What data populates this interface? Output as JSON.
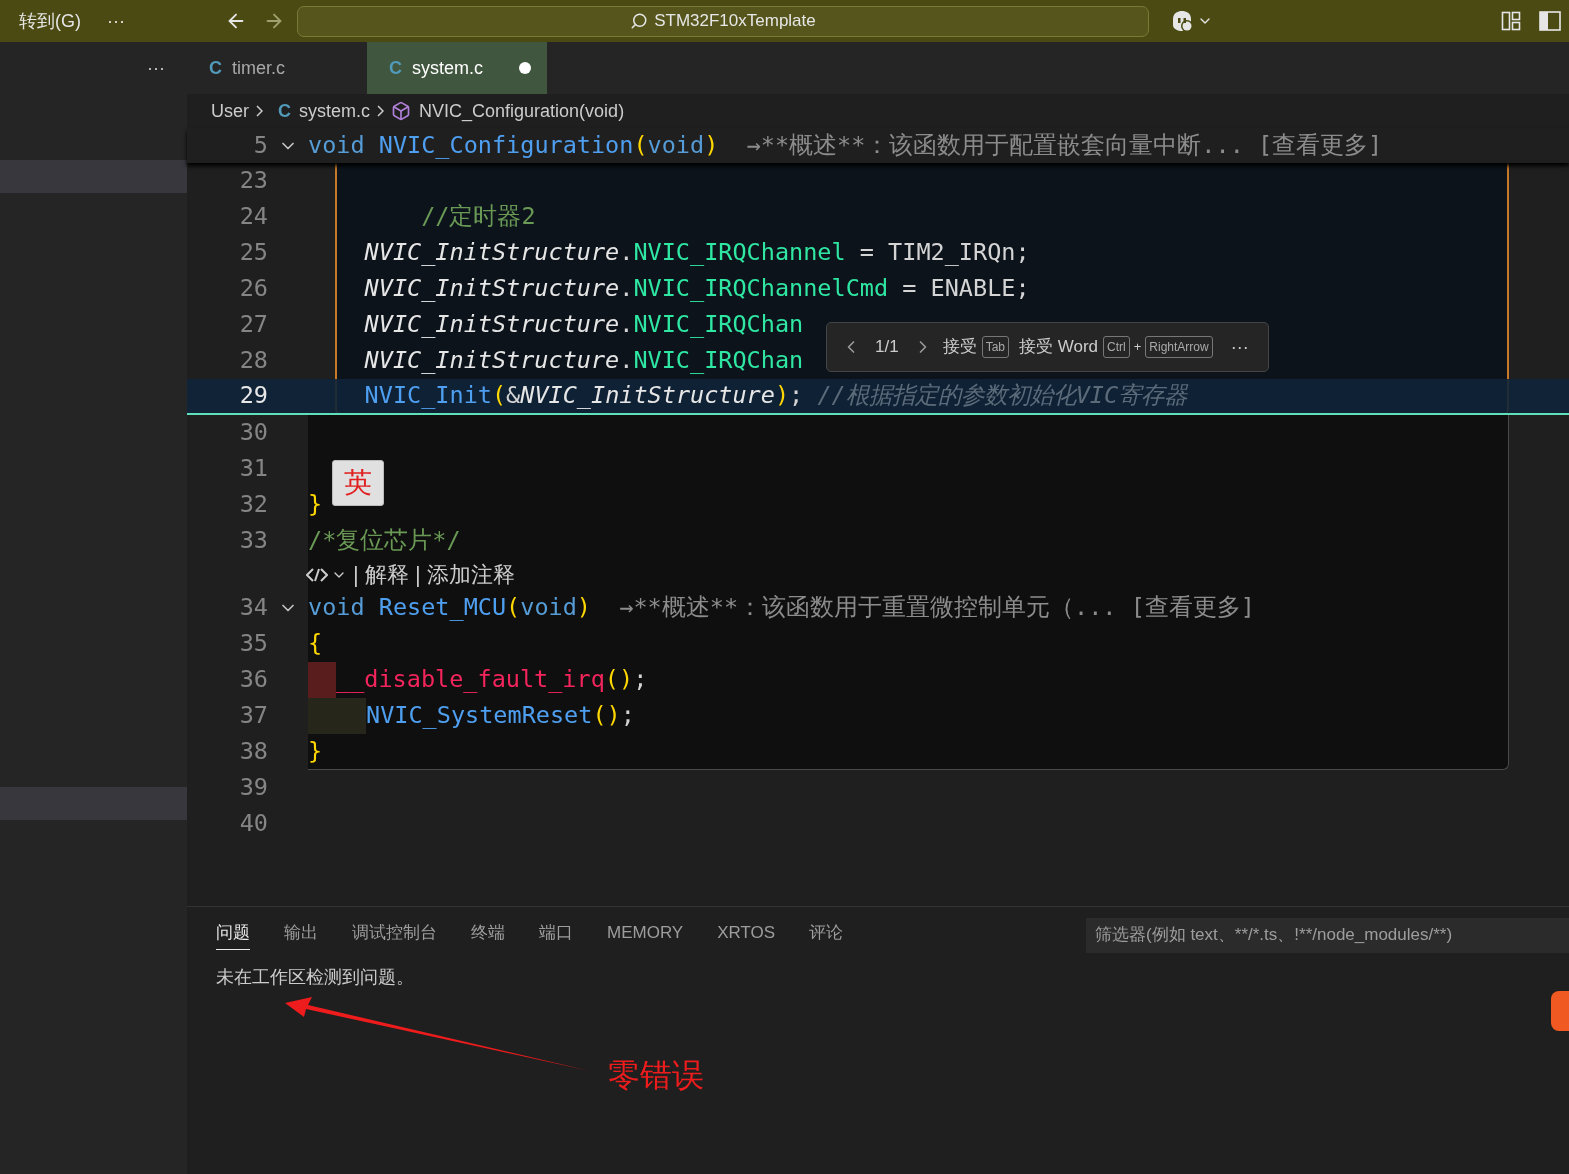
{
  "titlebar": {
    "menu": "转到(G)",
    "more": "···",
    "search": "STM32F10xTemplate"
  },
  "sidebar": {
    "more": "···"
  },
  "tabs": [
    {
      "icon": "C",
      "label": "timer.c",
      "selected": false,
      "modified": false
    },
    {
      "icon": "C",
      "label": "system.c",
      "selected": true,
      "modified": true
    }
  ],
  "breadcrumbs": [
    {
      "kind": "folder",
      "label": "User"
    },
    {
      "kind": "file",
      "icon": "C",
      "label": "system.c"
    },
    {
      "kind": "symbol",
      "label": "NVIC_Configuration(void)"
    }
  ],
  "sticky_line": {
    "number": "5",
    "expanded": true,
    "tokens": [
      {
        "kind": "kw",
        "text": "void "
      },
      {
        "kind": "func",
        "text": "NVIC_Configuration"
      },
      {
        "kind": "paren",
        "text": "("
      },
      {
        "kind": "kw",
        "text": "void"
      },
      {
        "kind": "paren",
        "text": ")"
      },
      {
        "kind": "hint",
        "text": "  →**概述**：该函数用于配置嵌套向量中断... [查看更多]"
      }
    ]
  },
  "lines": [
    {
      "kind": "suggested",
      "number": "23"
    },
    {
      "kind": "suggested",
      "number": "24",
      "tokens": [
        {
          "kind": "comment",
          "text": "        //定时器2"
        }
      ]
    },
    {
      "kind": "suggested",
      "number": "25",
      "tokens": [
        {
          "kind": "var",
          "text": "    NVIC_InitStructure"
        },
        {
          "kind": "plain",
          "text": "."
        },
        {
          "kind": "field",
          "text": "NVIC_IRQChannel"
        },
        {
          "kind": "plain",
          "text": " = TIM2_IRQn;"
        }
      ]
    },
    {
      "kind": "suggested",
      "number": "26",
      "tokens": [
        {
          "kind": "var",
          "text": "    NVIC_InitStructure"
        },
        {
          "kind": "plain",
          "text": "."
        },
        {
          "kind": "field",
          "text": "NVIC_IRQChannelCmd"
        },
        {
          "kind": "plain",
          "text": " = ENABLE;"
        }
      ]
    },
    {
      "kind": "suggested",
      "number": "27",
      "tokens": [
        {
          "kind": "var",
          "text": "    NVIC_InitStructure"
        },
        {
          "kind": "plain",
          "text": "."
        },
        {
          "kind": "field",
          "text": "NVIC_IRQChan"
        }
      ]
    },
    {
      "kind": "suggested",
      "number": "28",
      "tokens": [
        {
          "kind": "var",
          "text": "    NVIC_InitStructure"
        },
        {
          "kind": "plain",
          "text": "."
        },
        {
          "kind": "field",
          "text": "NVIC_IRQChan"
        }
      ]
    },
    {
      "kind": "current",
      "number": "29",
      "tokens": [
        {
          "kind": "func",
          "text": "    NVIC_Init"
        },
        {
          "kind": "paren",
          "text": "("
        },
        {
          "kind": "plain",
          "text": "&"
        },
        {
          "kind": "var",
          "text": "NVIC_InitStructure"
        },
        {
          "kind": "paren",
          "text": ")"
        },
        {
          "kind": "plain",
          "text": "; "
        },
        {
          "kind": "ghost",
          "text": "//根据指定的参数初始化VIC寄存器"
        }
      ]
    },
    {
      "kind": "preview",
      "number": "30"
    },
    {
      "kind": "preview",
      "number": "31"
    },
    {
      "kind": "preview",
      "number": "32",
      "tokens": [
        {
          "kind": "paren",
          "text": "}"
        }
      ]
    },
    {
      "kind": "preview",
      "number": "33",
      "tokens": [
        {
          "kind": "comment",
          "text": "/*复位芯片*/"
        }
      ]
    },
    {
      "kind": "codelens",
      "text": "| 解释 | 添加注释"
    },
    {
      "kind": "preview",
      "number": "34",
      "expanded": true,
      "tokens": [
        {
          "kind": "kw",
          "text": "void "
        },
        {
          "kind": "func",
          "text": "Reset_MCU"
        },
        {
          "kind": "paren",
          "text": "("
        },
        {
          "kind": "kw",
          "text": "void"
        },
        {
          "kind": "paren",
          "text": ")"
        },
        {
          "kind": "hint",
          "text": "  →**概述**：该函数用于重置微控制单元（... [查看更多]"
        }
      ]
    },
    {
      "kind": "preview",
      "number": "35",
      "tokens": [
        {
          "kind": "paren",
          "text": "{"
        }
      ]
    },
    {
      "kind": "deleted",
      "number": "36",
      "tokens": [
        {
          "kind": "error",
          "text": "__disable_fault_irq"
        },
        {
          "kind": "paren",
          "text": "()"
        },
        {
          "kind": "plain",
          "text": ";"
        }
      ]
    },
    {
      "kind": "inserted",
      "number": "37",
      "tokens": [
        {
          "kind": "func",
          "text": "NVIC_SystemReset"
        },
        {
          "kind": "paren",
          "text": "()"
        },
        {
          "kind": "plain",
          "text": ";"
        }
      ]
    },
    {
      "kind": "preview",
      "number": "38",
      "tokens": [
        {
          "kind": "paren",
          "text": "}"
        }
      ]
    },
    {
      "kind": "normal",
      "number": "39"
    },
    {
      "kind": "normal",
      "number": "40"
    }
  ],
  "inline_suggestion": {
    "position": "1/1",
    "accept": "接受",
    "accept_key": "Tab",
    "accept_word": "接受 Word",
    "word_keys": [
      "Ctrl",
      "RightArrow"
    ],
    "plus": "+",
    "more": "···"
  },
  "ime_badge": "英",
  "panel": {
    "tabs": [
      {
        "label": "问题",
        "selected": true
      },
      {
        "label": "输出",
        "selected": false
      },
      {
        "label": "调试控制台",
        "selected": false
      },
      {
        "label": "终端",
        "selected": false
      },
      {
        "label": "端口",
        "selected": false
      },
      {
        "label": "MEMORY",
        "selected": false
      },
      {
        "label": "XRTOS",
        "selected": false
      },
      {
        "label": "评论",
        "selected": false
      }
    ],
    "filter_placeholder": "筛选器(例如 text、**/*.ts、!**/node_modules/**)",
    "message": "未在工作区检测到问题。"
  },
  "annotation": {
    "text": "零错误"
  }
}
